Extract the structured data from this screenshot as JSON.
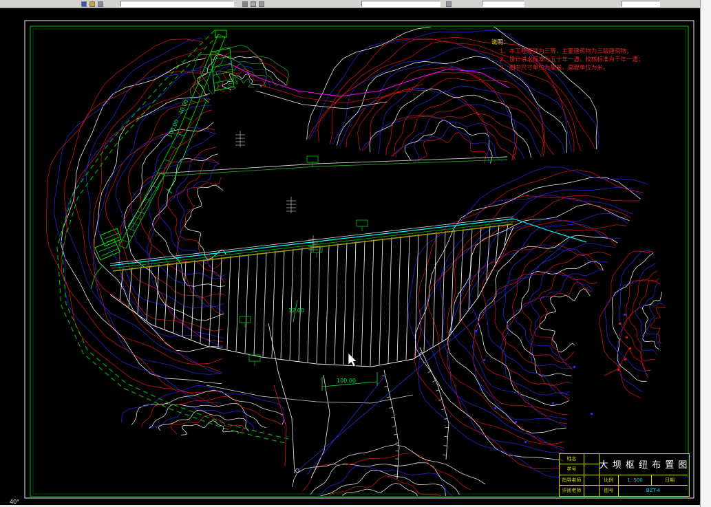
{
  "app": {
    "name": "CAD 图形窗口",
    "canvas_bg": "#000000",
    "toolbar_bg": "#d6d3ce",
    "coord_readout": "40°"
  },
  "notes": {
    "title": "说明：",
    "items": [
      "1、本工程等别为三等，主要建筑物为三级建筑物；",
      "2、设计洪水标准为五十年一遇，校核标准为千年一遇；",
      "3、图中尺寸单位为毫米，高程单位为米。"
    ]
  },
  "dimensions": {
    "spillway_length": "40.00",
    "spillway_width": "100.00",
    "dam_crest_width": "12.00",
    "dam_base_width": "100.00"
  },
  "title_block": {
    "rows": [
      {
        "label": "姓名"
      },
      {
        "label": "学号"
      },
      {
        "label": "指导老师"
      },
      {
        "label": "评阅老师"
      }
    ],
    "drawing_title": "大 坝 枢 纽 布 置 图",
    "scale_label": "比例",
    "scale_value": "1: 500",
    "date_label": "日期",
    "sheet_label": "图号",
    "sheet_value": "BZT-4"
  },
  "colors": {
    "contour_red": "#c81414",
    "contour_blue": "#2424d2",
    "contour_white": "#e6e6e6",
    "ridge_magenta": "#ff00ff",
    "dam_cyan": "#00ffff",
    "structure_green": "#00c000",
    "dimension_green": "#00ee44",
    "frame_green": "#00bb00",
    "titleblock_yellow": "#d6d600"
  }
}
